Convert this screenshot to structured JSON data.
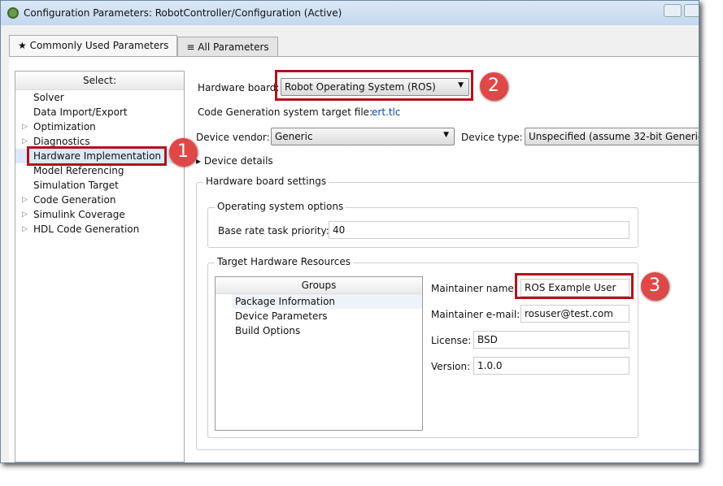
{
  "window": {
    "title": "Configuration Parameters: RobotController/Configuration (Active)"
  },
  "tabs": [
    {
      "label": "★ Commonly Used Parameters"
    },
    {
      "label": "≡ All Parameters"
    }
  ],
  "tree": {
    "header": "Select:",
    "items": [
      {
        "label": "Solver",
        "expandable": false
      },
      {
        "label": "Data Import/Export",
        "expandable": false
      },
      {
        "label": "Optimization",
        "expandable": true
      },
      {
        "label": "Diagnostics",
        "expandable": true
      },
      {
        "label": "Hardware Implementation",
        "expandable": false,
        "selected": true
      },
      {
        "label": "Model Referencing",
        "expandable": false
      },
      {
        "label": "Simulation Target",
        "expandable": false
      },
      {
        "label": "Code Generation",
        "expandable": true
      },
      {
        "label": "Simulink Coverage",
        "expandable": true
      },
      {
        "label": "HDL Code Generation",
        "expandable": true
      }
    ]
  },
  "main": {
    "hardware_board_label": "Hardware board:",
    "hardware_board": "Robot Operating System (ROS)",
    "target_file_label": "Code Generation system target file:",
    "target_file": "ert.tlc",
    "device_vendor_label": "Device vendor:",
    "device_vendor": "Generic",
    "device_type_label": "Device type:",
    "device_type": "Unspecified (assume 32-bit Generic",
    "device_details": "Device details",
    "hw_settings": "Hardware board settings",
    "os_options": "Operating system options",
    "priority_label": "Base rate task priority:",
    "priority": "40",
    "thr": "Target Hardware Resources",
    "groups_header": "Groups",
    "groups": [
      "Package Information",
      "Device Parameters",
      "Build Options"
    ],
    "maintainer_label": "Maintainer name:",
    "maintainer": "ROS Example User",
    "email_label": "Maintainer e-mail:",
    "email": "rosuser@test.com",
    "license_label": "License:",
    "license": "BSD",
    "version_label": "Version:",
    "version": "1.0.0"
  },
  "badges": [
    "1",
    "2",
    "3"
  ]
}
